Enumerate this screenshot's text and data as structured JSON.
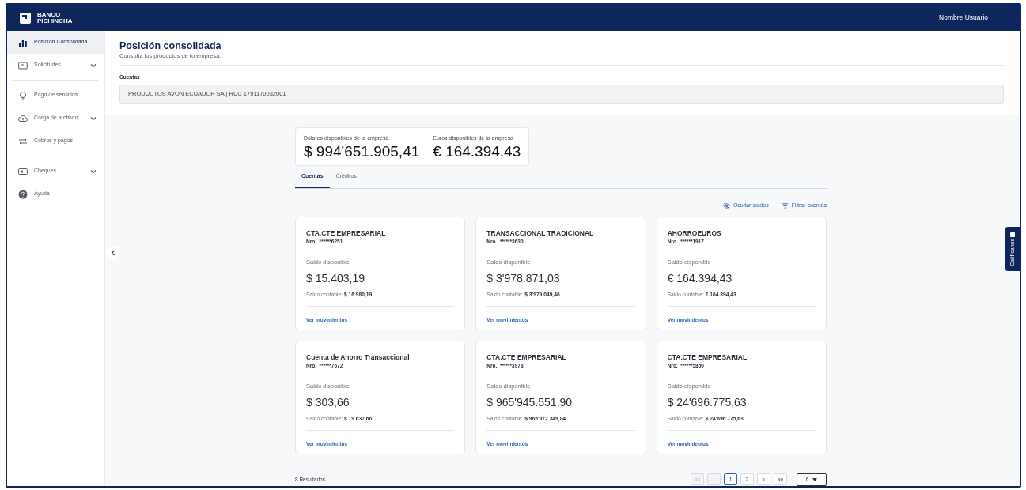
{
  "header": {
    "logo_text": "BANCO PICHINCHA",
    "user": "Nombre Usuario"
  },
  "sidebar": {
    "items": [
      {
        "label": "Posicion Consolidada",
        "selected": true,
        "expandable": false,
        "divider_after": false
      },
      {
        "label": "Solicitudes",
        "selected": false,
        "expandable": true,
        "divider_after": true
      },
      {
        "label": "Pago de servicios",
        "selected": false,
        "expandable": false,
        "divider_after": false
      },
      {
        "label": "Carga de archivos",
        "selected": false,
        "expandable": true,
        "divider_after": false
      },
      {
        "label": "Cobros y pagos",
        "selected": false,
        "expandable": false,
        "divider_after": true
      },
      {
        "label": "Cheques",
        "selected": false,
        "expandable": true,
        "divider_after": false
      },
      {
        "label": "Ayuda",
        "selected": false,
        "expandable": false,
        "divider_after": false
      }
    ]
  },
  "page": {
    "title": "Posición consolidada",
    "subtitle": "Consulta los productos de tu empresa.",
    "field_label": "Cuentas",
    "field_value": "PRODUCTOS AVON ECUADOR SA | RUC 1791170032001"
  },
  "totals": [
    {
      "label": "Dólares disponibles de la empresa",
      "amount": "$ 994'651.905,41"
    },
    {
      "label": "Euros disponibles de la empresa",
      "amount": "€ 164.394,43"
    }
  ],
  "tabs": [
    {
      "label": "Cuentas",
      "selected": true
    },
    {
      "label": "Créditos",
      "selected": false
    }
  ],
  "actions": [
    "Ocultar saldos",
    "Filtrar cuentas"
  ],
  "accounts": [
    {
      "name": "CTA.CTE EMPRESARIAL",
      "number": "Nro.  ******6251",
      "available_label": "Saldo disponible",
      "available": "$ 15.403,19",
      "book_label": "Saldo contable:",
      "book": "$ 16.980,19",
      "link": "Ver movimientos"
    },
    {
      "name": "TRANSACCIONAL TRADICIONAL",
      "number": "Nro.  ******3630",
      "available_label": "Saldo disponible",
      "available": "$ 3'978.871,03",
      "book_label": "Saldo contable:",
      "book": "$ 3'979.049,46",
      "link": "Ver movimientos"
    },
    {
      "name": "AHORROEUROS",
      "number": "Nro.  ******1917",
      "available_label": "Saldo disponible",
      "available": "€ 164.394,43",
      "book_label": "Saldo contable:",
      "book": "€ 164.394,43",
      "link": "Ver movimientos"
    },
    {
      "name": "Cuenta de Ahorro Transaccional",
      "number": "Nro.  ******7672",
      "available_label": "Saldo disponible",
      "available": "$ 303,66",
      "book_label": "Saldo contable:",
      "book": "$ 19.637,66",
      "link": "Ver movimientos"
    },
    {
      "name": "CTA.CTE EMPRESARIAL",
      "number": "Nro.  ******3978",
      "available_label": "Saldo disponible",
      "available": "$ 965'945.551,90",
      "book_label": "Saldo contable:",
      "book": "$ 965'972.349,84",
      "link": "Ver movimientos"
    },
    {
      "name": "CTA.CTE EMPRESARIAL",
      "number": "Nro.  ******5850",
      "available_label": "Saldo disponible",
      "available": "$ 24'696.775,63",
      "book_label": "Saldo contable:",
      "book": "$ 24'696.775,63",
      "link": "Ver movimientos"
    }
  ],
  "results": "8 Resultados",
  "pagination": [
    {
      "label": "««",
      "selected": false,
      "disabled": true
    },
    {
      "label": "‹",
      "selected": false,
      "disabled": true
    },
    {
      "label": "1",
      "selected": true,
      "disabled": false
    },
    {
      "label": "2",
      "selected": false,
      "disabled": false
    },
    {
      "label": "›",
      "selected": false,
      "disabled": false
    },
    {
      "label": "»»",
      "selected": false,
      "disabled": false
    }
  ],
  "page_size": "6",
  "feedback_tab": "Califícanos"
}
